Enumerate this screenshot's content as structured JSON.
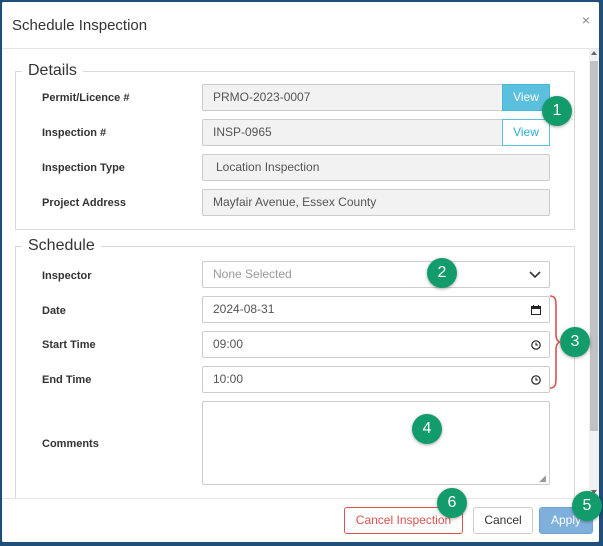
{
  "dialog": {
    "title": "Schedule Inspection",
    "close_glyph": "×"
  },
  "details": {
    "legend": "Details",
    "rows": {
      "permit": {
        "label": "Permit/Licence #",
        "value": "PRMO-2023-0007",
        "button": "View"
      },
      "inspection": {
        "label": "Inspection #",
        "value": "INSP-0965",
        "button": "View"
      },
      "type": {
        "label": "Inspection Type",
        "value": "Location Inspection"
      },
      "address": {
        "label": "Project Address",
        "value": "Mayfair Avenue, Essex County"
      }
    }
  },
  "schedule": {
    "legend": "Schedule",
    "inspector": {
      "label": "Inspector",
      "placeholder": "None Selected"
    },
    "date": {
      "label": "Date",
      "value": "2024-08-31"
    },
    "start": {
      "label": "Start Time",
      "value": "09:00"
    },
    "end": {
      "label": "End Time",
      "value": "10:00"
    },
    "comments": {
      "label": "Comments",
      "value": ""
    }
  },
  "footer": {
    "cancel_inspection": "Cancel Inspection",
    "cancel": "Cancel",
    "apply": "Apply"
  },
  "callouts": {
    "c1": "1",
    "c2": "2",
    "c3": "3",
    "c4": "4",
    "c5": "5",
    "c6": "6"
  },
  "colors": {
    "frame": "#1f4e79",
    "callout": "#129b6b",
    "brace": "#d9534f",
    "view_button": "#5bc0de",
    "danger": "#d9534f",
    "apply": "#7fb0dc"
  },
  "icons": {
    "calendar": "calendar-icon",
    "clock": "clock-icon",
    "chevron": "chevron-down-icon",
    "close": "close-icon"
  }
}
